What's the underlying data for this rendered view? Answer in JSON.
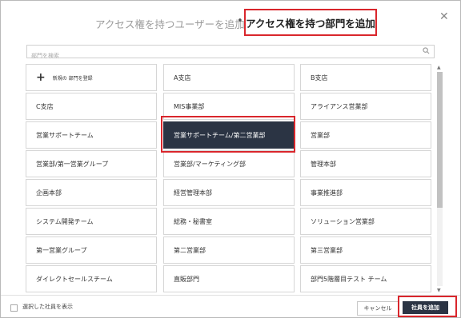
{
  "header": {
    "tab_users": "アクセス権を持つユーザーを追加",
    "separator": "•",
    "tab_departments": "アクセス権を持つ部門を追加",
    "close": "✕"
  },
  "search": {
    "placeholder": "部門を検索"
  },
  "grid": {
    "new_department": "新規の 部門を登録",
    "cells": [
      "A支店",
      "B支店",
      "C支店",
      "MIS事業部",
      "アライアンス営業部",
      "営業サポートチーム",
      "営業サポートチーム/第二営業部",
      "営業部",
      "営業部/第一営業グループ",
      "営業部/マーケティング部",
      "管理本部",
      "企画本部",
      "経営管理本部",
      "事業推進部",
      "システム開発チーム",
      "総務・秘書室",
      "ソリューション営業部",
      "第一営業グループ",
      "第二営業部",
      "第三営業部",
      "ダイレクトセールスチーム",
      "直販部門",
      "部門5階層目テスト チーム"
    ],
    "selected": "営業サポートチーム/第二営業部"
  },
  "footer": {
    "show_selected": "選択した社員を表示",
    "cancel": "キャンセル",
    "add": "社員を追加"
  },
  "colors": {
    "primary": "#2b3444",
    "highlight": "#d9262c"
  }
}
